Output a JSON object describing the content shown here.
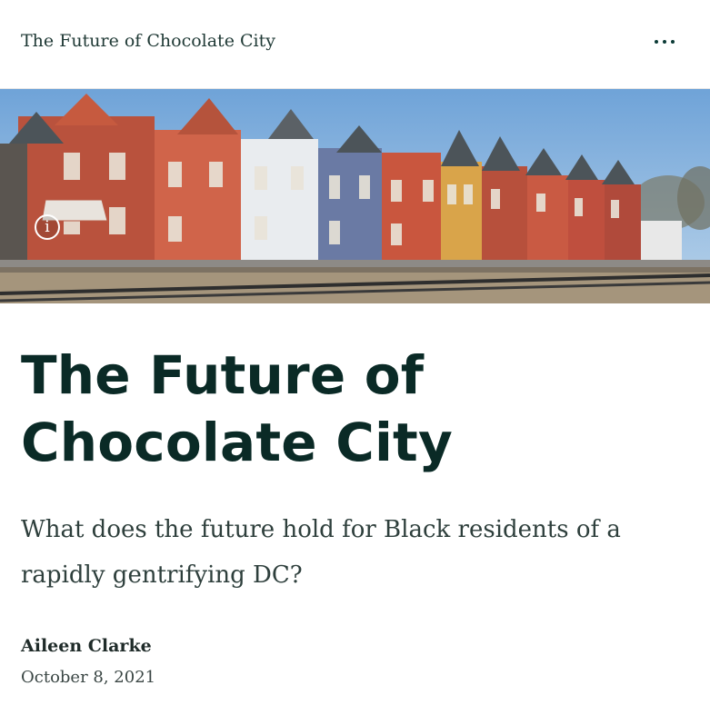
{
  "header": {
    "site_title": "The Future of Chocolate City",
    "menu_icon": "more-horizontal-icon"
  },
  "hero": {
    "info_icon": "info-icon",
    "info_glyph": "i",
    "description_colors": {
      "sky": "#8fb8df",
      "brick": "#c9563e",
      "white_house": "#e9ecef",
      "blue_house": "#6a7aa4",
      "yellow_house": "#d9a44a",
      "roof": "#4c5459",
      "wall": "#a5957c"
    }
  },
  "article": {
    "title": "The Future of Chocolate City",
    "subtitle": "What does the future hold for Black residents of a rapidly gentrifying DC?",
    "author": "Aileen Clarke",
    "date": "October 8, 2021"
  },
  "theme": {
    "heading_color": "#0a2a26",
    "body_color": "#2e3f3c"
  }
}
